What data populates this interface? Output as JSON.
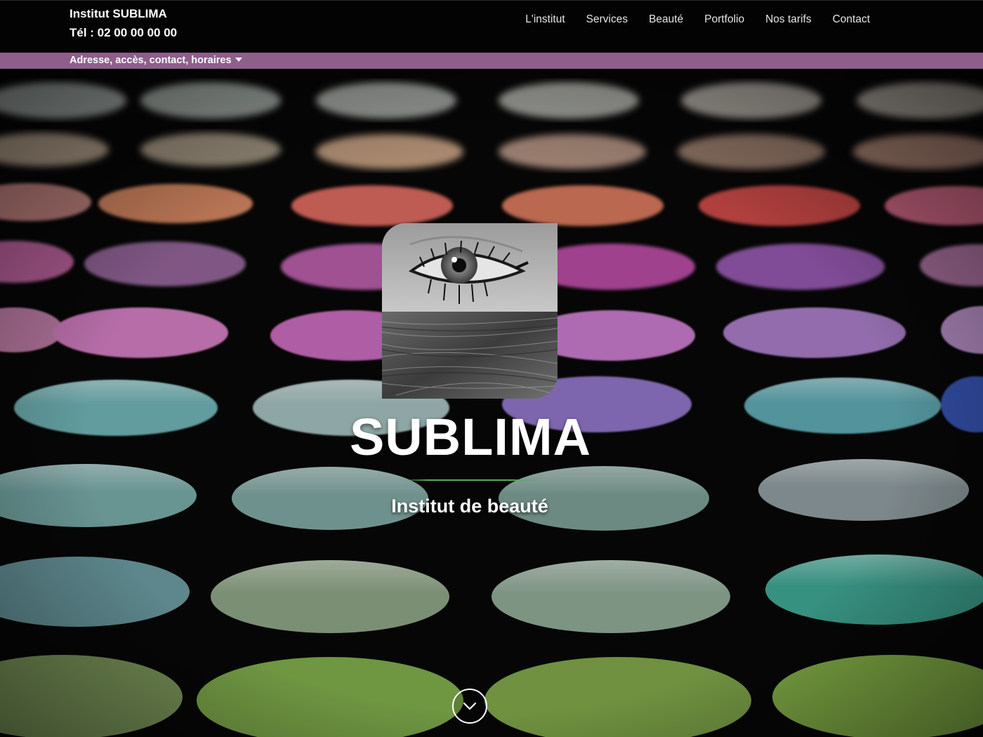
{
  "header": {
    "brand_name": "Institut SUBLIMA",
    "phone": "Tél : 02 00 00 00 00",
    "background": "#030303"
  },
  "nav": {
    "items": [
      {
        "label": "L'institut"
      },
      {
        "label": "Services"
      },
      {
        "label": "Beauté"
      },
      {
        "label": "Portfolio"
      },
      {
        "label": "Nos tarifs"
      },
      {
        "label": "Contact"
      }
    ]
  },
  "info_bar": {
    "label": "Adresse, accès, contact, horaires",
    "icon": "caret-down-icon",
    "color": "#8d5f8a"
  },
  "hero": {
    "title": "SUBLIMA",
    "subtitle": "Institut de beauté",
    "accent_rule_color": "#5aaa5a",
    "logo_icon": "eye-and-hair-logo",
    "scroll_icon": "chevron-down-circle-icon"
  }
}
